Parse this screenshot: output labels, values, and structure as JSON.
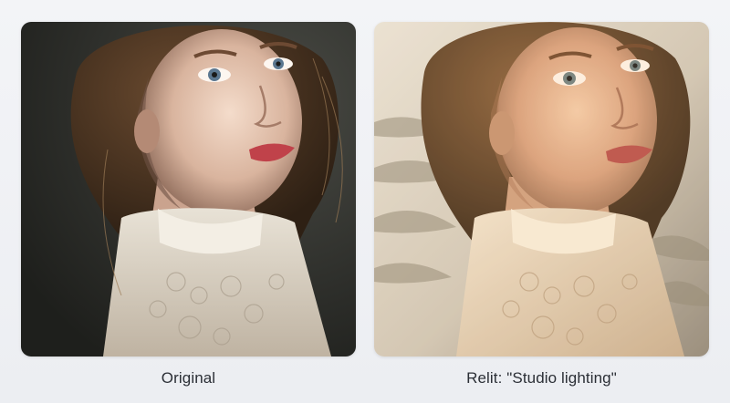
{
  "comparison": {
    "original": {
      "caption": "Original",
      "image_icon": "portrait-photo"
    },
    "relit": {
      "caption": "Relit: \"Studio lighting\"",
      "image_icon": "portrait-photo-relit"
    }
  },
  "colors": {
    "background": "#eef0f4",
    "caption_text": "#2b2f36",
    "original_backdrop": "#2e2f2b",
    "relit_backdrop": "#d9d3c6"
  }
}
